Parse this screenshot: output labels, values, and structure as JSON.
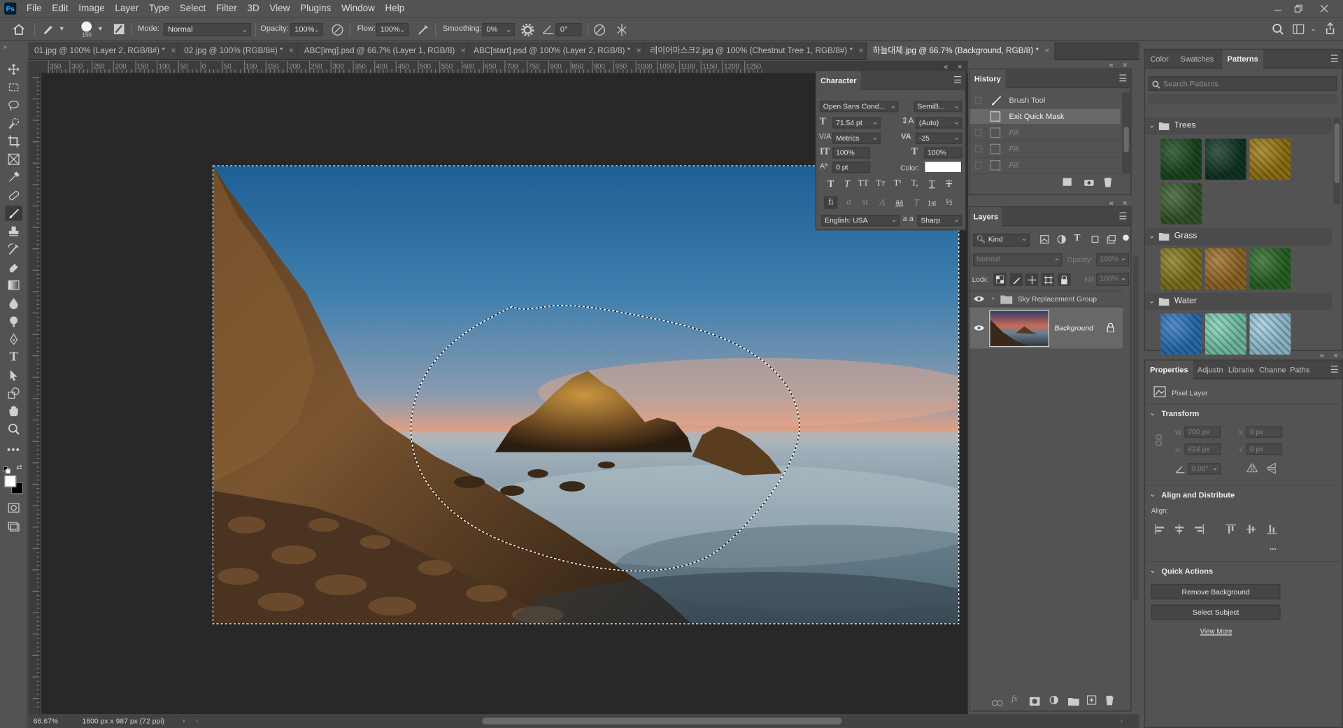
{
  "menu": [
    "File",
    "Edit",
    "Image",
    "Layer",
    "Type",
    "Select",
    "Filter",
    "3D",
    "View",
    "Plugins",
    "Window",
    "Help"
  ],
  "app_logo": "Ps",
  "options": {
    "brush_size": "150",
    "mode_label": "Mode:",
    "mode_value": "Normal",
    "opacity_label": "Opacity:",
    "opacity_value": "100%",
    "flow_label": "Flow:",
    "flow_value": "100%",
    "smoothing_label": "Smoothing:",
    "smoothing_value": "0%",
    "angle_value": "0°"
  },
  "tabs": [
    {
      "label": "01.jpg @ 100% (Layer 2, RGB/8#) *"
    },
    {
      "label": "02.jpg @ 100% (RGB/8#) *"
    },
    {
      "label": "ABC[img].psd @ 66.7% (Layer 1, RGB/8)"
    },
    {
      "label": "ABC[start].psd @ 100% (Layer 2, RGB/8) *"
    },
    {
      "label": "레이어마스크2.jpg @ 100% (Chestnut Tree 1, RGB/8#) *"
    },
    {
      "label": "하늘대체.jpg @ 66.7% (Background, RGB/8) *"
    }
  ],
  "ruler_top": [
    "350",
    "300",
    "250",
    "200",
    "150",
    "100",
    "50",
    "0",
    "50",
    "100",
    "150",
    "200",
    "250",
    "300",
    "350",
    "400",
    "450",
    "500",
    "550",
    "600",
    "650",
    "700",
    "750",
    "800",
    "850",
    "900",
    "950",
    "1000",
    "1050",
    "1100",
    "1150",
    "1200",
    "1250"
  ],
  "status": {
    "zoom": "66.67%",
    "doc_info": "1600 px x 987 px (72 ppi)"
  },
  "character": {
    "title": "Character",
    "font_family": "Open Sans Cond...",
    "font_style": "SemiB...",
    "size": "71.54 pt",
    "leading": "(Auto)",
    "kerning": "Metrics",
    "tracking": "-25",
    "vscale": "100%",
    "hscale": "100%",
    "baseline": "0 pt",
    "color_label": "Color:",
    "color_value": "#ffffff",
    "language": "English: USA",
    "aa_label": "a a",
    "antialias": "Sharp",
    "type_buttons": [
      "T",
      "T",
      "TT",
      "Tт",
      "T¹",
      "T,",
      "T",
      "T"
    ],
    "otype_buttons": [
      "fi",
      "ơ",
      "st",
      "A",
      "aa",
      "T",
      "1st",
      "½"
    ]
  },
  "history": {
    "title": "History",
    "items": [
      {
        "label": "Brush Tool",
        "dim": false
      },
      {
        "label": "Exit Quick Mask",
        "dim": false
      },
      {
        "label": "Fill",
        "dim": true
      },
      {
        "label": "Fill",
        "dim": true
      },
      {
        "label": "Fill",
        "dim": true
      }
    ]
  },
  "layers": {
    "title": "Layers",
    "filter_kind": "Kind",
    "blend_mode": "Normal",
    "opacity_label": "Opacity:",
    "opacity_value": "100%",
    "lock_label": "Lock:",
    "fill_label": "Fill:",
    "fill_value": "100%",
    "items": [
      {
        "name": "Sky Replacement Group",
        "type": "group"
      },
      {
        "name": "Background",
        "type": "pixel"
      }
    ]
  },
  "right_panel": {
    "tabs": [
      "Color",
      "Swatches",
      "Patterns"
    ],
    "search_placeholder": "Search Patterns",
    "groups": [
      {
        "name": "Trees",
        "colors": [
          "#1d4d22",
          "#143a28",
          "#a07d15",
          "#3b5e2d"
        ]
      },
      {
        "name": "Grass",
        "colors": [
          "#8a7d1e",
          "#a0702a",
          "#2c6d2a"
        ]
      },
      {
        "name": "Water",
        "colors": [
          "#2f78c2",
          "#7dd1b2",
          "#9ecde0"
        ]
      }
    ]
  },
  "properties": {
    "tabs": [
      "Properties",
      "Adjustn",
      "Librarie",
      "Channe",
      "Paths"
    ],
    "kind": "Pixel Layer",
    "transform_title": "Transform",
    "w_label": "W",
    "w_value": "700 px",
    "h_label": "H",
    "h_value": "424 px",
    "x_label": "X",
    "x_value": "0 px",
    "y_label": "Y",
    "y_value": "0 px",
    "angle_value": "0.00°",
    "align_title": "Align and Distribute",
    "align_label": "Align:",
    "more": "...",
    "quick_title": "Quick Actions",
    "remove_bg": "Remove Background",
    "select_subject": "Select Subject",
    "view_more": "View More"
  }
}
